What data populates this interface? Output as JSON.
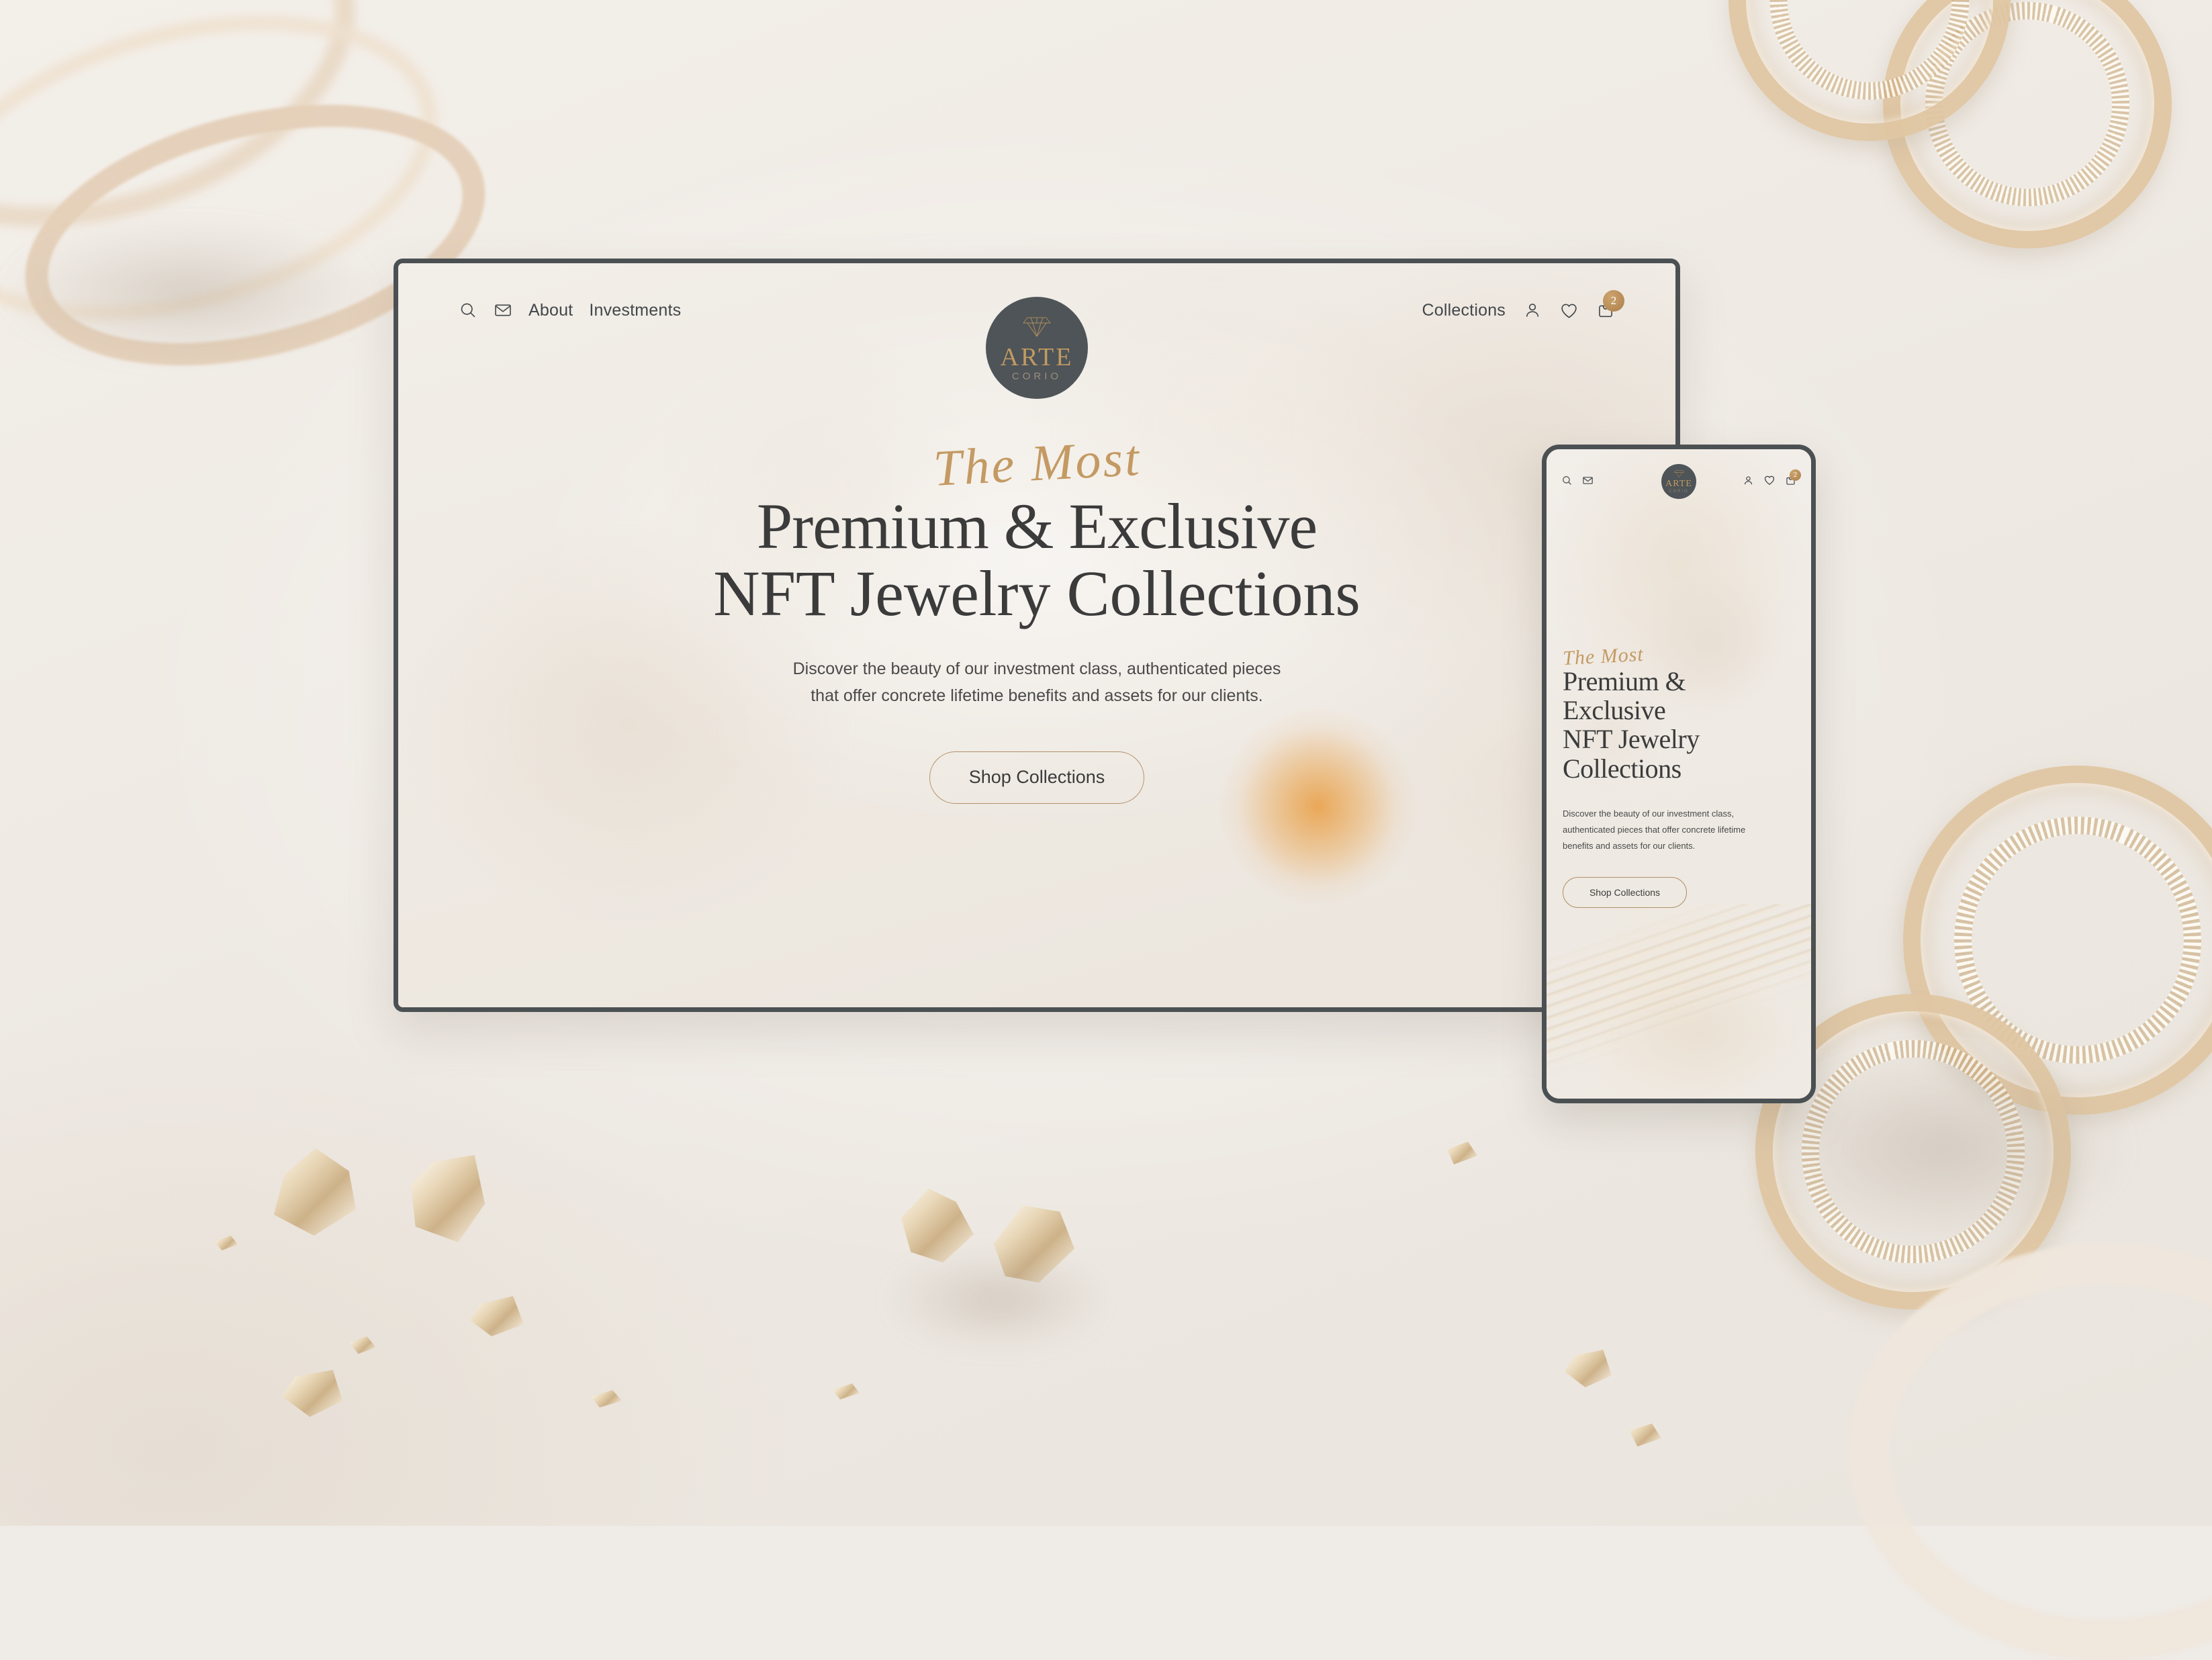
{
  "background": {
    "scene": "blurred gold jewelry flat-lay on cream surface with gold leaf flakes"
  },
  "desktop": {
    "nav": {
      "search_icon": "search-icon",
      "mail_icon": "mail-icon",
      "links": [
        {
          "label": "About"
        },
        {
          "label": "Investments"
        }
      ],
      "right_link": "Collections",
      "account_icon": "user-icon",
      "wishlist_icon": "heart-icon",
      "cart_icon": "shopping-bag-icon",
      "cart_count": "2"
    },
    "logo": {
      "mark": "diamond-icon",
      "word": "ARTE",
      "sub": "CORIO"
    },
    "hero": {
      "eyebrow": "The Most",
      "headline_line1": "Premium & Exclusive",
      "headline_line2": "NFT Jewelry Collections",
      "subcopy_line1": "Discover the beauty of our investment class, authenticated pieces",
      "subcopy_line2": "that offer concrete lifetime benefits and assets for our clients.",
      "cta_label": "Shop Collections"
    }
  },
  "phone": {
    "nav": {
      "search_icon": "search-icon",
      "mail_icon": "mail-icon",
      "account_icon": "user-icon",
      "wishlist_icon": "heart-icon",
      "cart_icon": "shopping-bag-icon",
      "cart_count": "2"
    },
    "logo": {
      "mark": "diamond-icon",
      "word": "ARTE",
      "sub": "CORIO"
    },
    "hero": {
      "eyebrow": "The Most",
      "headline_line1": "Premium &",
      "headline_line2": "Exclusive",
      "headline_line3": "NFT Jewelry",
      "headline_line4": "Collections",
      "subcopy_line1": "Discover the beauty of our investment class,",
      "subcopy_line2": "authenticated pieces that offer concrete lifetime",
      "subcopy_line3": "benefits and assets for our clients.",
      "cta_label": "Shop Collections"
    }
  },
  "colors": {
    "gold": "#c49a63",
    "bronze_badge": "#ab7f4b",
    "frame_border": "#4b5053",
    "logo_bg": "#4e5457",
    "text_dark": "#3b3b3b",
    "page_bg": "#efebe6",
    "screen_bg": "#f1ece6",
    "hero_glow_orange": "#e9963 2"
  }
}
